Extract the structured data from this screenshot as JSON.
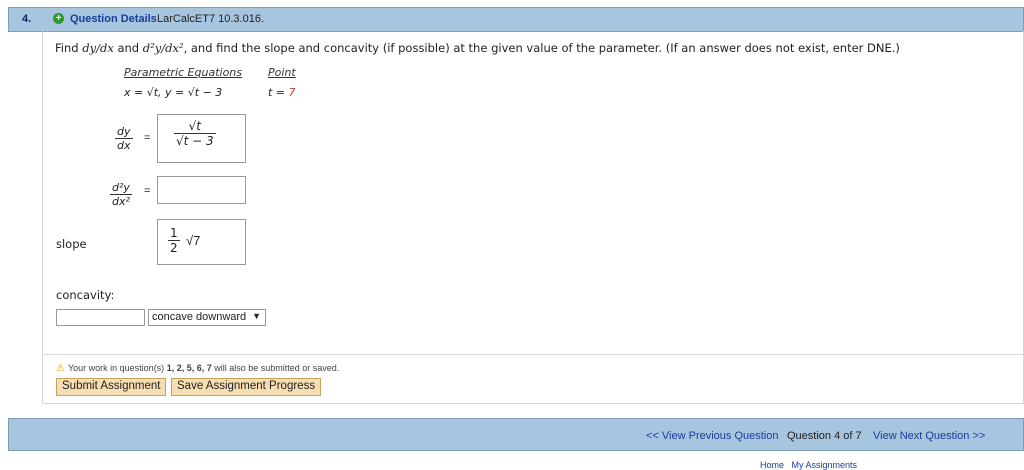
{
  "question": {
    "number": "4.",
    "details_label": "Question Details",
    "id": "LarCalcET7 10.3.016.",
    "prompt_1": "Find ",
    "prompt_dydx": "dy/dx",
    "prompt_2": " and ",
    "prompt_d2": "d²y/dx²",
    "prompt_3": ", and find the slope and concavity (if possible) at the given value of the parameter. (If an answer does not exist, enter DNE.)"
  },
  "equations": {
    "header_param": "Parametric Equations",
    "header_point": "Point",
    "x_eq": "x = √t,  y = √t − 3",
    "t_eq_left": "t = ",
    "t_eq_val": "7"
  },
  "answers": {
    "dydx_num": "dy",
    "dydx_den": "dx",
    "dydx_value_num": "√t",
    "dydx_value_den": "√t − 3",
    "d2y_num": "d²y",
    "d2y_den": "dx²",
    "d2y_value": "",
    "slope_label": "slope",
    "slope_value_num": "1",
    "slope_value_den": "2",
    "slope_value_rad": "√7",
    "concavity_label": "concavity:",
    "concavity_input": "",
    "concavity_select": "concave downward"
  },
  "footer_area": {
    "warning_pre": "Your work in question(s) ",
    "warning_list": "1, 2, 5, 6, 7",
    "warning_post": " will also be submitted or saved.",
    "submit_label": "Submit Assignment",
    "save_label": "Save Assignment Progress"
  },
  "nav": {
    "prev_label": "<< View Previous Question",
    "counter": "Question 4 of 7",
    "next_label": "View Next Question >>",
    "home_label": "Home",
    "assign_label": "My Assignments"
  },
  "colors": {
    "header_blue": "#a7c5de",
    "link_blue": "#1a3d9c",
    "button_fill": "#f7ddb2",
    "accent_red": "#c0392b"
  }
}
